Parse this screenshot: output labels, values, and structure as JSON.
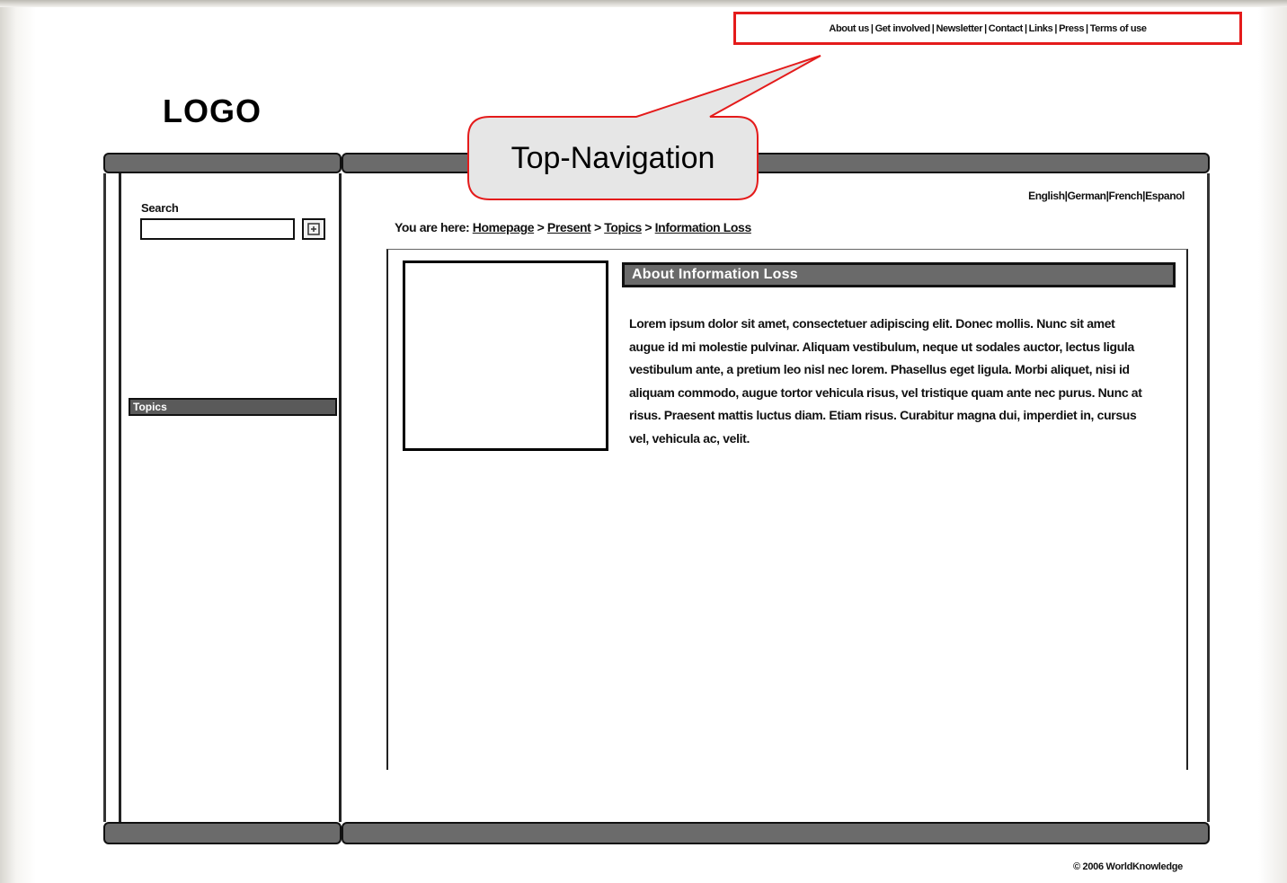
{
  "top_navigation": {
    "links": [
      "About us",
      "Get involved",
      "Newsletter",
      "Contact",
      "Links",
      "Press",
      "Terms of use"
    ]
  },
  "logo": "LOGO",
  "callout": {
    "label": "Top-Navigation"
  },
  "sidebar": {
    "search_label": "Search",
    "search_value": "",
    "topics_header": "Topics"
  },
  "languages": [
    "English",
    "German",
    "French",
    "Espanol"
  ],
  "breadcrumb": {
    "prefix": "You are here:",
    "items": [
      "Homepage",
      "Present",
      "Topics",
      "Information Loss"
    ]
  },
  "article": {
    "heading": "About Information Loss",
    "body": "Lorem ipsum dolor sit amet, consectetuer adipiscing elit. Donec mollis. Nunc sit amet augue id mi molestie pulvinar. Aliquam vestibulum, neque ut sodales auctor, lectus ligula vestibulum ante, a pretium leo nisl nec lorem. Phasellus eget ligula. Morbi aliquet, nisi id aliquam commodo, augue tortor vehicula risus, vel tristique quam ante nec purus. Nunc at risus. Praesent mattis luctus diam. Etiam risus. Curabitur magna dui, imperdiet in, cursus vel, vehicula ac, velit."
  },
  "footer": {
    "copyright": "© 2006 WorldKnowledge"
  },
  "colors": {
    "annotation_red": "#e41b1b",
    "callout_fill": "#e6e6e6",
    "bar_gray": "#6b6b6b"
  }
}
